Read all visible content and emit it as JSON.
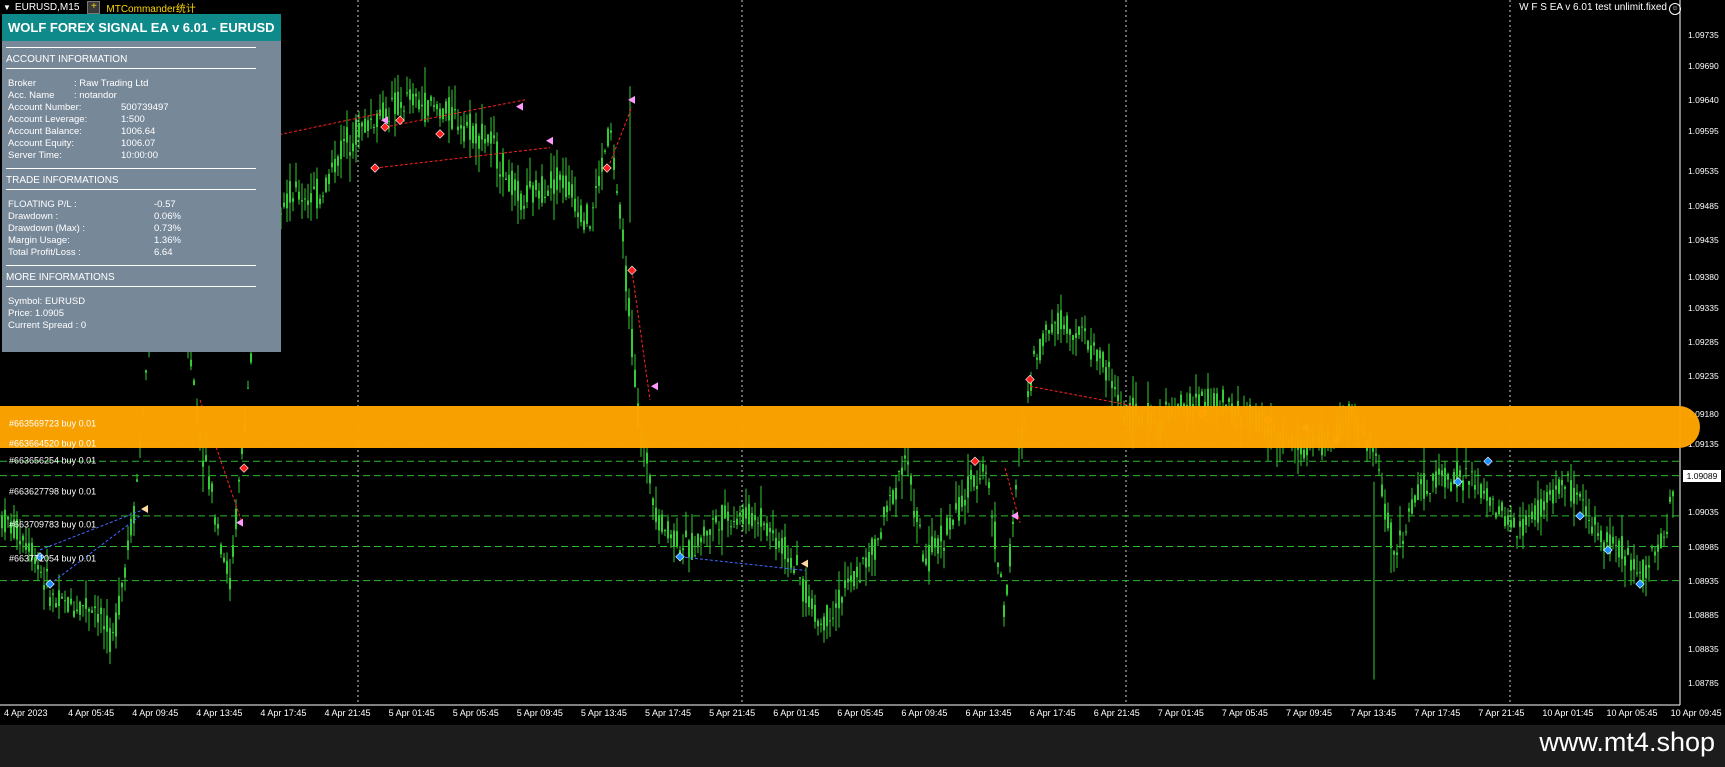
{
  "window": {
    "symbol_timeframe": "EURUSD,M15",
    "add_icon": "plus-icon",
    "indicator_name": "MTCommander统计",
    "ea_label": "W F S EA v 6.01 test unlimit.fixed",
    "ea_icon": "smiley-icon"
  },
  "panel": {
    "title": "WOLF FOREX SIGNAL EA v 6.01 - EURUSD",
    "account_section": "ACCOUNT INFORMATION",
    "account_rows": [
      {
        "label": "Broker",
        "value": ":  Raw Trading Ltd"
      },
      {
        "label": "Acc. Name",
        "value": ":  notandor"
      },
      {
        "label": "Account Number:",
        "value": "500739497"
      },
      {
        "label": "Account Leverage:",
        "value": "1:500"
      },
      {
        "label": "Account Balance:",
        "value": "1006.64"
      },
      {
        "label": "Account Equity:",
        "value": "1006.07"
      },
      {
        "label": "Server Time:",
        "value": "10:00:00"
      }
    ],
    "trade_section": "TRADE INFORMATIONS",
    "trade_rows": [
      {
        "label": "FLOATING P/L :",
        "value": "-0.57"
      },
      {
        "label": "Drawdown :",
        "value": "0.06%"
      },
      {
        "label": "Drawdown (Max) :",
        "value": "0.73%"
      },
      {
        "label": "Margin Usage:",
        "value": "1.36%"
      },
      {
        "label": "Total Profit/Loss :",
        "value": "6.64"
      }
    ],
    "more_section": "MORE INFORMATIONS",
    "more_rows": [
      {
        "label": "Symbol: EURUSD"
      },
      {
        "label": "Price:  1.0905"
      },
      {
        "label": "Current Spread  :  0"
      }
    ]
  },
  "orders": [
    {
      "label": "#663569723 buy 0.01",
      "price": 1.09135
    },
    {
      "label": "#663664520 buy 0.01",
      "price": 1.0911
    },
    {
      "label": "#663656254 buy 0.01",
      "price": 1.09089
    },
    {
      "label": "#663627798 buy 0.01",
      "price": 1.0903
    },
    {
      "label": "#663709783 buy 0.01",
      "price": 1.08985
    },
    {
      "label": "#663771054 buy 0.01",
      "price": 1.08935
    }
  ],
  "price_axis": {
    "ticks": [
      "1.09735",
      "1.09690",
      "1.09640",
      "1.09595",
      "1.09535",
      "1.09485",
      "1.09435",
      "1.09380",
      "1.09335",
      "1.09285",
      "1.09235",
      "1.09180",
      "1.09135",
      "1.09035",
      "1.08985",
      "1.08935",
      "1.08885",
      "1.08835",
      "1.08785"
    ],
    "current_price": "1.09089",
    "range": [
      1.0876,
      1.0976
    ]
  },
  "time_axis": {
    "ticks": [
      "4 Apr 2023",
      "4 Apr 05:45",
      "4 Apr 09:45",
      "4 Apr 13:45",
      "4 Apr 17:45",
      "4 Apr 21:45",
      "5 Apr 01:45",
      "5 Apr 05:45",
      "5 Apr 09:45",
      "5 Apr 13:45",
      "5 Apr 17:45",
      "5 Apr 21:45",
      "6 Apr 01:45",
      "6 Apr 05:45",
      "6 Apr 09:45",
      "6 Apr 13:45",
      "6 Apr 17:45",
      "6 Apr 21:45",
      "7 Apr 01:45",
      "7 Apr 05:45",
      "7 Apr 09:45",
      "7 Apr 13:45",
      "7 Apr 17:45",
      "7 Apr 21:45",
      "10 Apr 01:45",
      "10 Apr 05:45",
      "10 Apr 09:45"
    ]
  },
  "footer": {
    "site": "www.mt4.shop"
  },
  "colors": {
    "candle": "#32cd32",
    "background": "#000000",
    "panel_bg": "#778899",
    "panel_header": "#0e8a8a",
    "highlight_band": "#ffa500",
    "order_line": "#2eb82e",
    "sell_marker": "#ff0000",
    "buy_marker": "#1e90ff"
  }
}
